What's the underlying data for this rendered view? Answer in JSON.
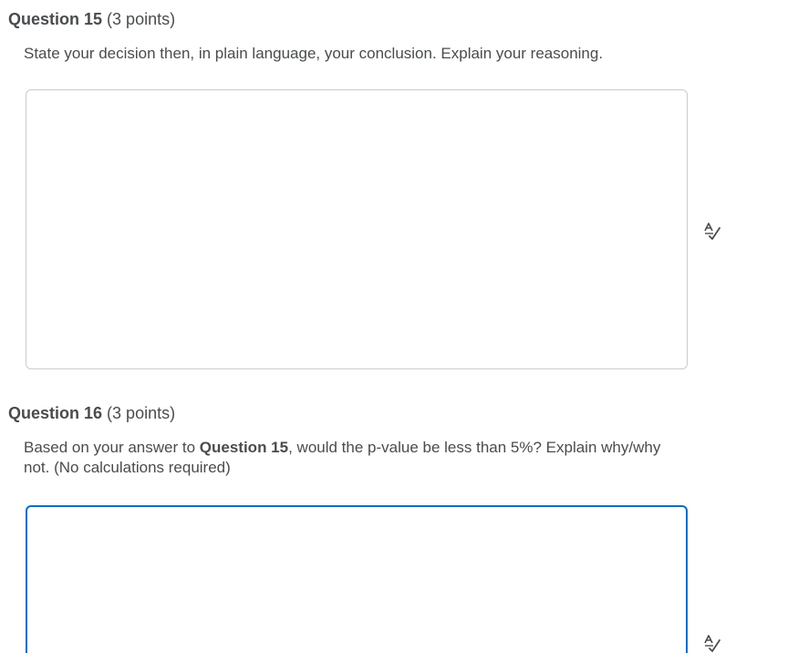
{
  "questions": [
    {
      "title": "Question 15",
      "points": "(3 points)",
      "prompt": "State your decision then, in plain language, your conclusion. Explain your reasoning.",
      "answer_value": "",
      "spellcheck_icon": "spellcheck-icon"
    },
    {
      "title": "Question 16",
      "points": "(3 points)",
      "prompt_part1": "Based on your answer to ",
      "prompt_bold": "Question 15",
      "prompt_part2": ", would the p-value be less than 5%? Explain why/why not. (No calculations required)",
      "answer_value": "",
      "spellcheck_icon": "spellcheck-icon"
    }
  ],
  "colors": {
    "text": "#494c4e",
    "border": "#c8ccd0",
    "focus_border": "#006fbf"
  }
}
